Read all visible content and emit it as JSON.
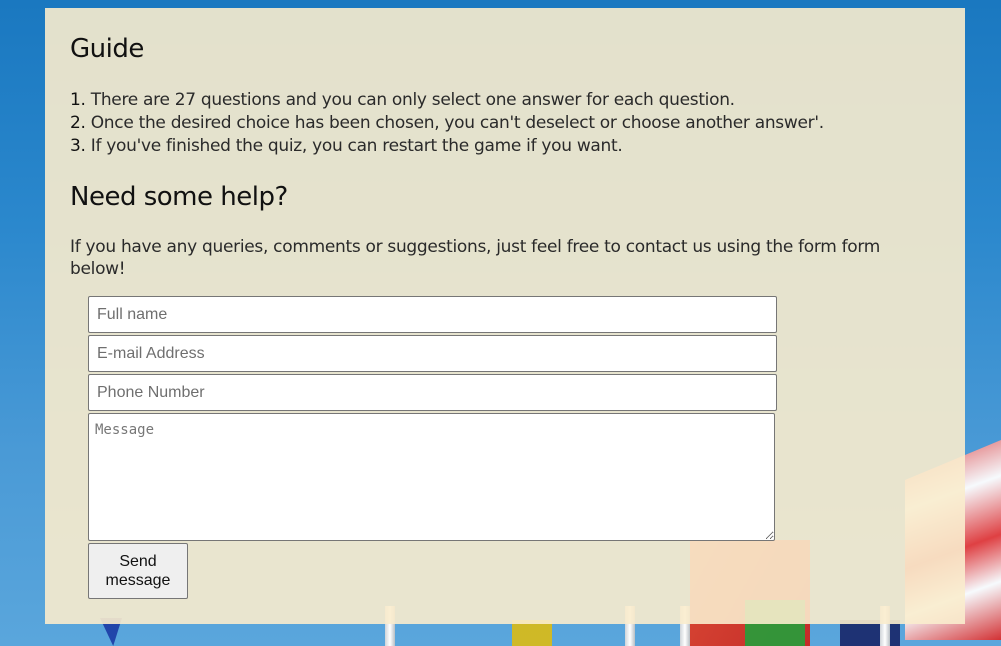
{
  "guide": {
    "title": "Guide",
    "items": [
      {
        "num": "1.",
        "text": " There are 27 questions and you can only select one answer for each question."
      },
      {
        "num": "2.",
        "text": " Once the desired choice has been chosen, you can't deselect or choose another answer'."
      },
      {
        "num": "3.",
        "text": " If you've finished the quiz, you can restart the game if you want."
      }
    ]
  },
  "help": {
    "title": "Need some help?",
    "text": "If you have any queries, comments or suggestions, just feel free to contact us using the form form below!"
  },
  "form": {
    "fullname_placeholder": "Full name",
    "email_placeholder": "E-mail Address",
    "phone_placeholder": "Phone Number",
    "message_placeholder": "Message",
    "send_label": "Send message"
  },
  "colors": {
    "panel_bg": "#faeccd",
    "sky": "#2b88cd"
  }
}
